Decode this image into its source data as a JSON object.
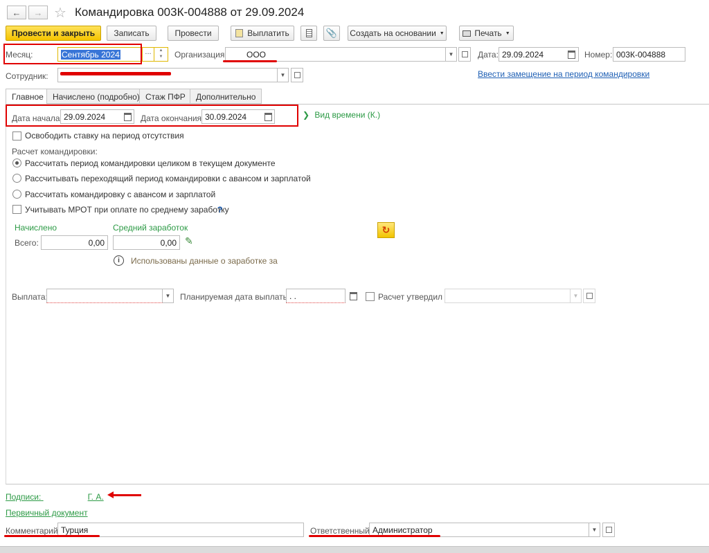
{
  "window": {
    "title": "Командировка 003К-004888 от 29.09.2024"
  },
  "toolbar": {
    "post_and_close": "Провести и закрыть",
    "save": "Записать",
    "post": "Провести",
    "pay": "Выплатить",
    "create_based_on": "Создать на основании",
    "print": "Печать"
  },
  "header": {
    "month_label": "Месяц:",
    "month_value": "Сентябрь 2024",
    "organization_label": "Организация:",
    "organization_value": "ООО",
    "date_label": "Дата:",
    "date_value": "29.09.2024",
    "number_label": "Номер:",
    "number_value": "003К-004888",
    "employee_label": "Сотрудник:",
    "substitution_link": "Ввести замещение на период командировки"
  },
  "tabs": [
    {
      "label": "Главное",
      "active": true
    },
    {
      "label": "Начислено (подробно)",
      "active": false
    },
    {
      "label": "Стаж ПФР",
      "active": false
    },
    {
      "label": "Дополнительно",
      "active": false
    }
  ],
  "main": {
    "start_label": "Дата начала:",
    "start_value": "29.09.2024",
    "end_label": "Дата окончания:",
    "end_value": "30.09.2024",
    "time_type": "Вид времени (К.)",
    "free_rate": "Освободить ставку на период отсутствия",
    "calc_title": "Расчет командировки:",
    "calc_options": [
      "Рассчитать период командировки целиком в текущем документе",
      "Рассчитывать переходящий период командировки с авансом и зарплатой",
      "Рассчитать командировку с авансом и зарплатой"
    ],
    "calc_selected": 0,
    "mrot": "Учитывать МРОТ при оплате по среднему заработку",
    "mrot_help": "?",
    "accrued_title": "Начислено",
    "total_label": "Всего:",
    "total_value": "0,00",
    "avg_title": "Средний заработок",
    "avg_value": "0,00",
    "info_text": "Использованы данные о заработке за",
    "payment_label": "Выплата:",
    "planned_date_label": "Планируемая дата выплаты:",
    "planned_date_value": " .  .",
    "approved_label": "Расчет утвердил"
  },
  "footer": {
    "signatures_link": "Подписи:",
    "signatures_value": "Г. А.",
    "primary_doc": "Первичный документ",
    "comment_label": "Комментарий:",
    "comment_value": "Турция",
    "responsible_label": "Ответственный:",
    "responsible_value": "Администратор"
  },
  "colors": {
    "primary_button": "#f5c400",
    "annotation_red": "#e00000",
    "accent_green": "#2c9a45",
    "link_blue": "#1e5fb4"
  }
}
